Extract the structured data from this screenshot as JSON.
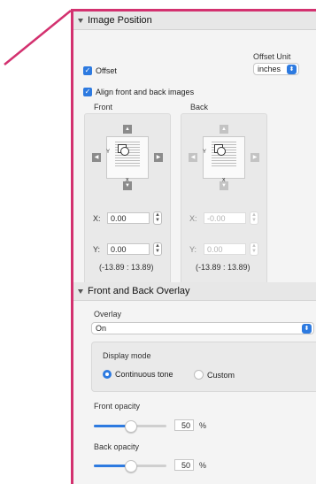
{
  "image_position": {
    "title": "Image Position",
    "offset_unit_label": "Offset Unit",
    "offset_unit_value": "inches",
    "offset_label": "Offset",
    "offset_checked": true,
    "align_label": "Align front and back images",
    "align_checked": true,
    "front": {
      "label": "Front",
      "x_label": "X:",
      "x_value": "0.00",
      "y_label": "Y:",
      "y_value": "0.00",
      "range": "(-13.89 : 13.89)",
      "thumb_x": "x",
      "thumb_y": "Y"
    },
    "back": {
      "label": "Back",
      "x_label": "X:",
      "x_value": "-0.00",
      "y_label": "Y:",
      "y_value": "0.00",
      "range": "(-13.89 : 13.89)",
      "thumb_x": "x",
      "thumb_y": "Y"
    }
  },
  "overlay_section": {
    "title": "Front and Back Overlay",
    "overlay_label": "Overlay",
    "overlay_value": "On",
    "display_mode_label": "Display mode",
    "mode_continuous": "Continuous tone",
    "mode_custom": "Custom",
    "selected_mode": "Continuous tone",
    "front_opacity_label": "Front opacity",
    "front_opacity_value": "50",
    "front_opacity_unit": "%",
    "back_opacity_label": "Back opacity",
    "back_opacity_value": "50",
    "back_opacity_unit": "%"
  },
  "colors": {
    "accent": "#2d7ae0",
    "highlight_border": "#d3316f"
  }
}
